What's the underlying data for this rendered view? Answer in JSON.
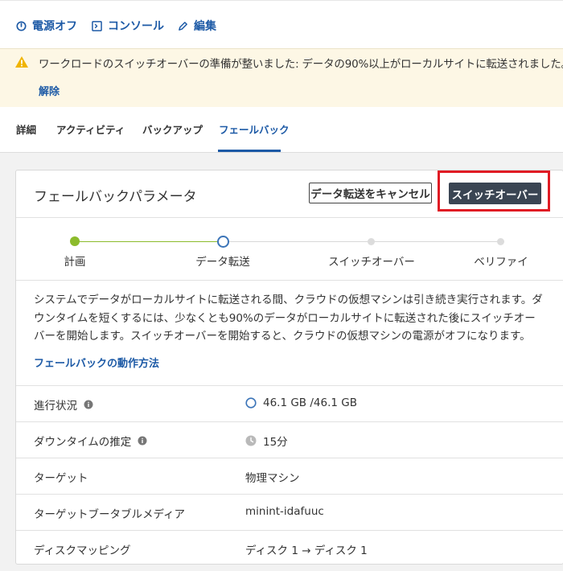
{
  "toolbar": {
    "power_off": "電源オフ",
    "console": "コンソール",
    "edit": "編集"
  },
  "banner": {
    "message": "ワークロードのスイッチオーバーの準備が整いました: データの90%以上がローカルサイトに転送されました。",
    "dismiss": "解除"
  },
  "tabs": [
    "詳細",
    "アクティビティ",
    "バックアップ",
    "フェールバック"
  ],
  "active_tab": "フェールバック",
  "card": {
    "title": "フェールバックパラメータ",
    "cancel_button": "データ転送をキャンセル",
    "switchover_button": "スイッチオーバー"
  },
  "steps": [
    {
      "label": "計画",
      "state": "done"
    },
    {
      "label": "データ転送",
      "state": "current"
    },
    {
      "label": "スイッチオーバー",
      "state": "pending"
    },
    {
      "label": "ベリファイ",
      "state": "pending"
    }
  ],
  "description": "システムでデータがローカルサイトに転送される間、クラウドの仮想マシンは引き続き実行されます。ダウンタイムを短くするには、少なくとも90%のデータがローカルサイトに転送された後にスイッチオーバーを開始します。スイッチオーバーを開始すると、クラウドの仮想マシンの電源がオフになります。",
  "description_link": "フェールバックの動作方法",
  "details": [
    {
      "label": "進行状況",
      "value": "46.1 GB /46.1 GB",
      "has_info": true,
      "value_icon": "progress-ring-icon"
    },
    {
      "label": "ダウンタイムの推定",
      "value": "15分",
      "has_info": true,
      "value_icon": "clock-icon"
    },
    {
      "label": "ターゲット",
      "value": "物理マシン",
      "has_info": false,
      "value_icon": ""
    },
    {
      "label": "ターゲットブータブルメディア",
      "value": "minint-idafuuc",
      "has_info": false,
      "value_icon": ""
    },
    {
      "label": "ディスクマッピング",
      "value": "ディスク 1 → ディスク 1",
      "has_info": false,
      "value_icon": ""
    }
  ],
  "colors": {
    "link": "#1d5aa6",
    "step_done": "#8cbb2c",
    "step_current": "#3b74b8",
    "primary_button": "#3a4553",
    "highlight": "#e01b24",
    "banner_bg": "#fdf7e5",
    "warning": "#f0b400"
  }
}
